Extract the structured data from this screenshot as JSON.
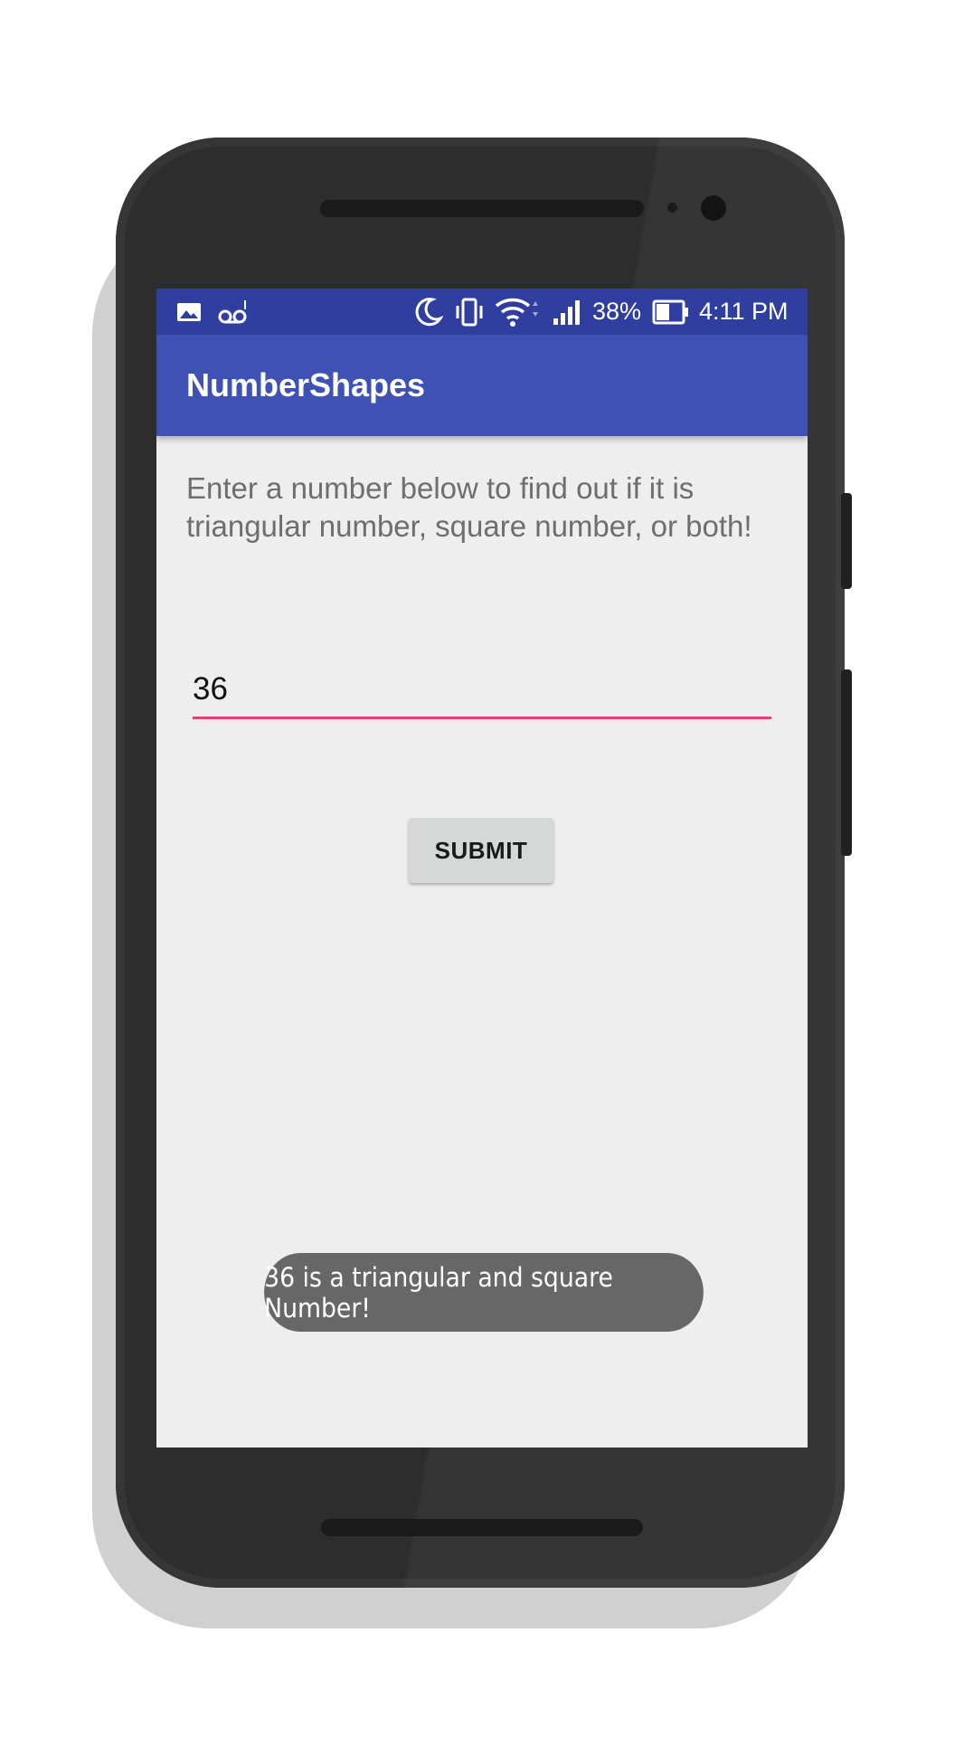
{
  "statusbar": {
    "battery_percent": "38%",
    "time": "4:11 PM",
    "icons": [
      "gallery-notification-icon",
      "voicemail-icon",
      "do-not-disturb-moon-icon",
      "vibrate-icon",
      "wifi-icon",
      "cell-signal-icon",
      "battery-icon"
    ]
  },
  "app": {
    "title": "NumberShapes"
  },
  "main": {
    "instruction": "Enter a number below to find out if it is triangular number, square number, or both!",
    "number_input_value": "36",
    "submit_label": "SUBMIT"
  },
  "toast": {
    "message": "36 is a triangular and square Number!"
  },
  "colors": {
    "statusbar": "#303f9f",
    "appbar": "#3f51b5",
    "accent": "#e0437a",
    "toast": "#676767"
  }
}
